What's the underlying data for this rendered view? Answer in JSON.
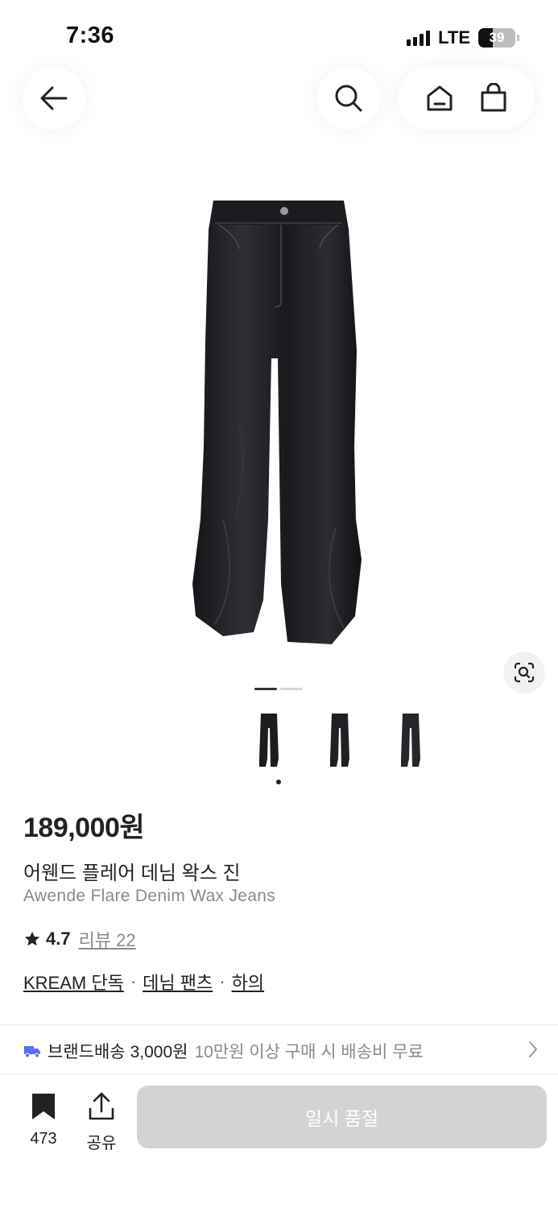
{
  "status_bar": {
    "time": "7:36",
    "network": "LTE",
    "battery": "39"
  },
  "nav": {
    "back_icon": "arrow-left-icon",
    "search_icon": "search-icon",
    "home_icon": "home-icon",
    "cart_icon": "shopping-bag-icon"
  },
  "gallery": {
    "page_count": 2,
    "active_page": 1,
    "thumbnail_count": 3,
    "active_thumbnail": 1,
    "lens_icon": "image-search-icon"
  },
  "product": {
    "price": "189,000원",
    "name_ko": "어웬드 플레어 데님 왁스 진",
    "name_en": "Awende Flare Denim Wax Jeans",
    "rating": "4.7",
    "review_label": "리뷰 22",
    "tags": [
      "KREAM 단독",
      "데님 팬츠",
      "하의"
    ],
    "tag_separator": "·"
  },
  "shipping": {
    "label": "브랜드배송",
    "price": "3,000원",
    "note": "10만원 이상 구매 시 배송비 무료"
  },
  "bottom_bar": {
    "bookmark_count": "473",
    "share_label": "공유",
    "cta_label": "일시 품절"
  },
  "colors": {
    "accent_blue": "#5b6cf0",
    "cta_disabled": "#d3d3d3"
  }
}
